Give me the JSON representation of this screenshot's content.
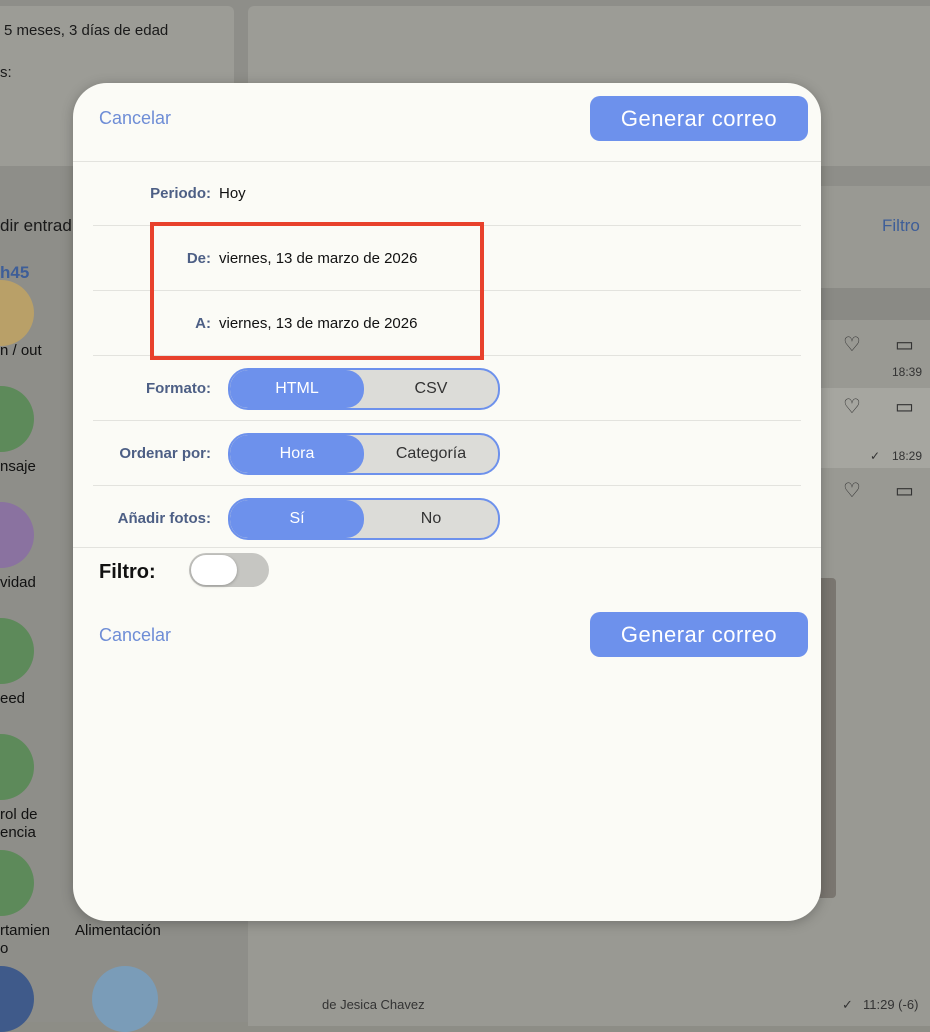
{
  "background": {
    "age_text": "5 meses, 3 días de edad",
    "colon_text": "s:",
    "add_entry_text": "dir entrad",
    "filter_text": "Filtro",
    "count_text": "h45",
    "icons": [
      {
        "label": "n / out",
        "color": "#b9a068",
        "icon": "home-icon"
      },
      {
        "label": "nsaje",
        "color": "#5d8a5a",
        "icon": "message-icon"
      },
      {
        "label": "vidad",
        "color": "#8a72a0",
        "icon": "activity-icon"
      },
      {
        "label": "eed",
        "color": "#5d8a5a",
        "icon": "feed-icon"
      },
      {
        "label": "rol de\nencia",
        "color": "#5d8a5a",
        "icon": "attendance-icon"
      },
      {
        "label": "rtamien\no",
        "color": "#5d8a5a",
        "icon": "behavior-icon"
      }
    ],
    "alimentacion_label": "Alimentación",
    "feed_times": [
      "18:39",
      "18:29"
    ],
    "author_text": "de Jesica Chavez",
    "footer_time": "11:29 (-6)"
  },
  "modal": {
    "cancel_label": "Cancelar",
    "generate_label": "Generar correo",
    "period": {
      "label": "Periodo:",
      "value": "Hoy"
    },
    "from": {
      "label": "De:",
      "value": "viernes, 13 de marzo de 2026"
    },
    "to": {
      "label": "A:",
      "value": "viernes, 13 de marzo de 2026"
    },
    "format": {
      "label": "Formato:",
      "options": [
        "HTML",
        "CSV"
      ],
      "selected": "HTML"
    },
    "order": {
      "label": "Ordenar por:",
      "options": [
        "Hora",
        "Categoría"
      ],
      "selected": "Hora"
    },
    "photos": {
      "label": "Añadir fotos:",
      "options": [
        "Sí",
        "No"
      ],
      "selected": "Sí"
    },
    "filter": {
      "label": "Filtro:",
      "enabled": false
    },
    "accent_color": "#6d91ec",
    "highlight_color": "#e8412c"
  }
}
